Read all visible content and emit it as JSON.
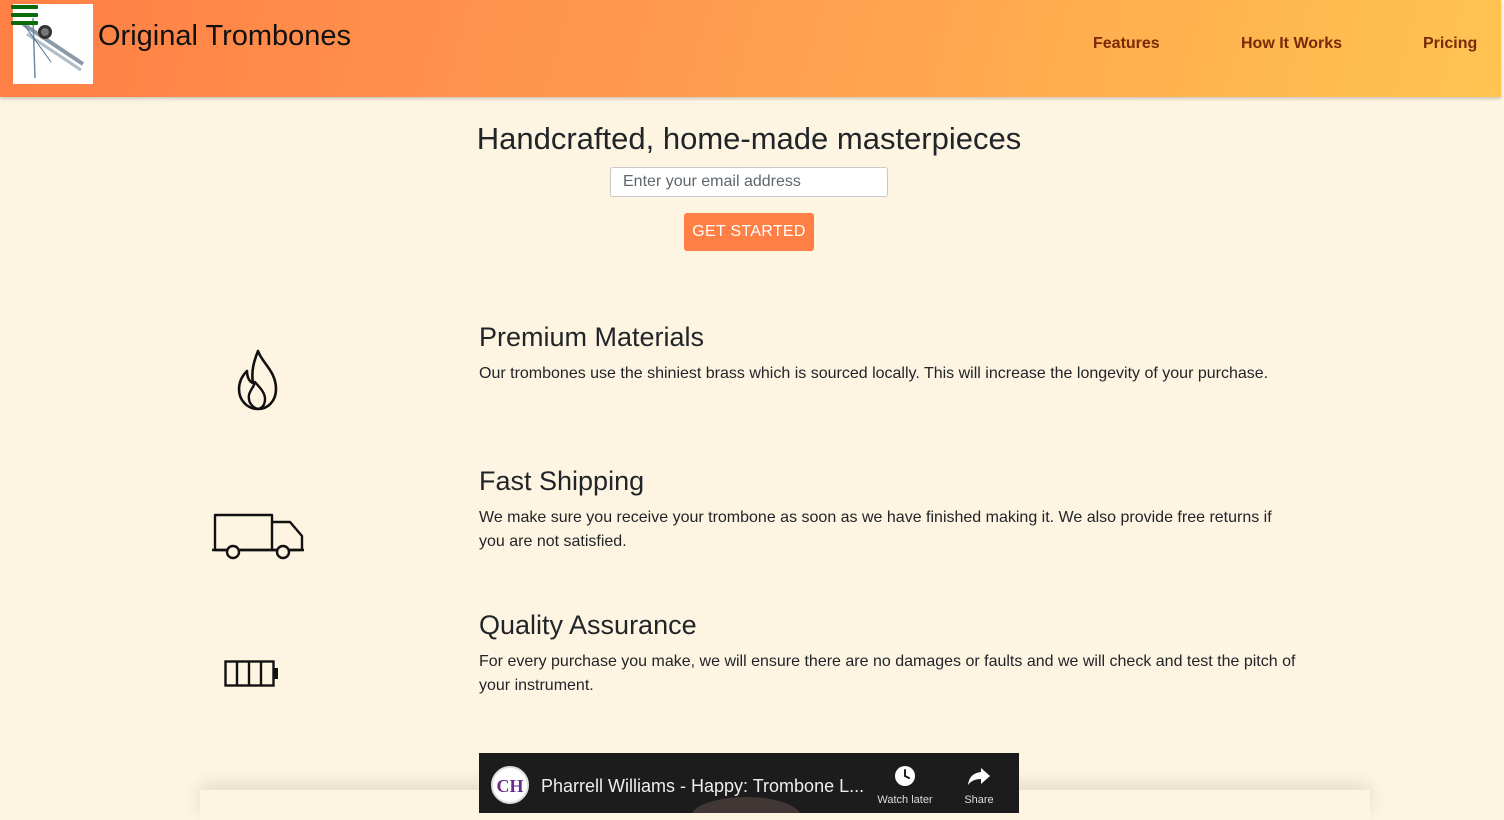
{
  "header": {
    "brand_title": "Original Trombones",
    "nav": {
      "features": "Features",
      "how_it_works": "How It Works",
      "pricing": "Pricing"
    }
  },
  "hero": {
    "heading": "Handcrafted, home-made masterpieces",
    "email_placeholder": "Enter your email address",
    "cta_label": "GET STARTED"
  },
  "features": [
    {
      "icon": "fire-icon",
      "title": "Premium Materials",
      "text": "Our trombones use the shiniest brass which is sourced locally. This will increase the longevity of your purchase."
    },
    {
      "icon": "truck-icon",
      "title": "Fast Shipping",
      "text": "We make sure you receive your trombone as soon as we have finished making it. We also provide free returns if you are not satisfied."
    },
    {
      "icon": "battery-icon",
      "title": "Quality Assurance",
      "text": "For every purchase you make, we will ensure there are no damages or faults and we will check and test the pitch of your instrument."
    }
  ],
  "video": {
    "title": "Pharrell Williams - Happy: Trombone L...",
    "channel_initials": "CH",
    "watch_later_label": "Watch later",
    "share_label": "Share"
  },
  "colors": {
    "header_gradient_start": "#ff7f45",
    "header_gradient_end": "#ffc452",
    "page_background": "#fef4e2",
    "nav_link": "#7a2a06",
    "cta_background": "#ff7f45",
    "hamburger": "#0b6b0b"
  }
}
